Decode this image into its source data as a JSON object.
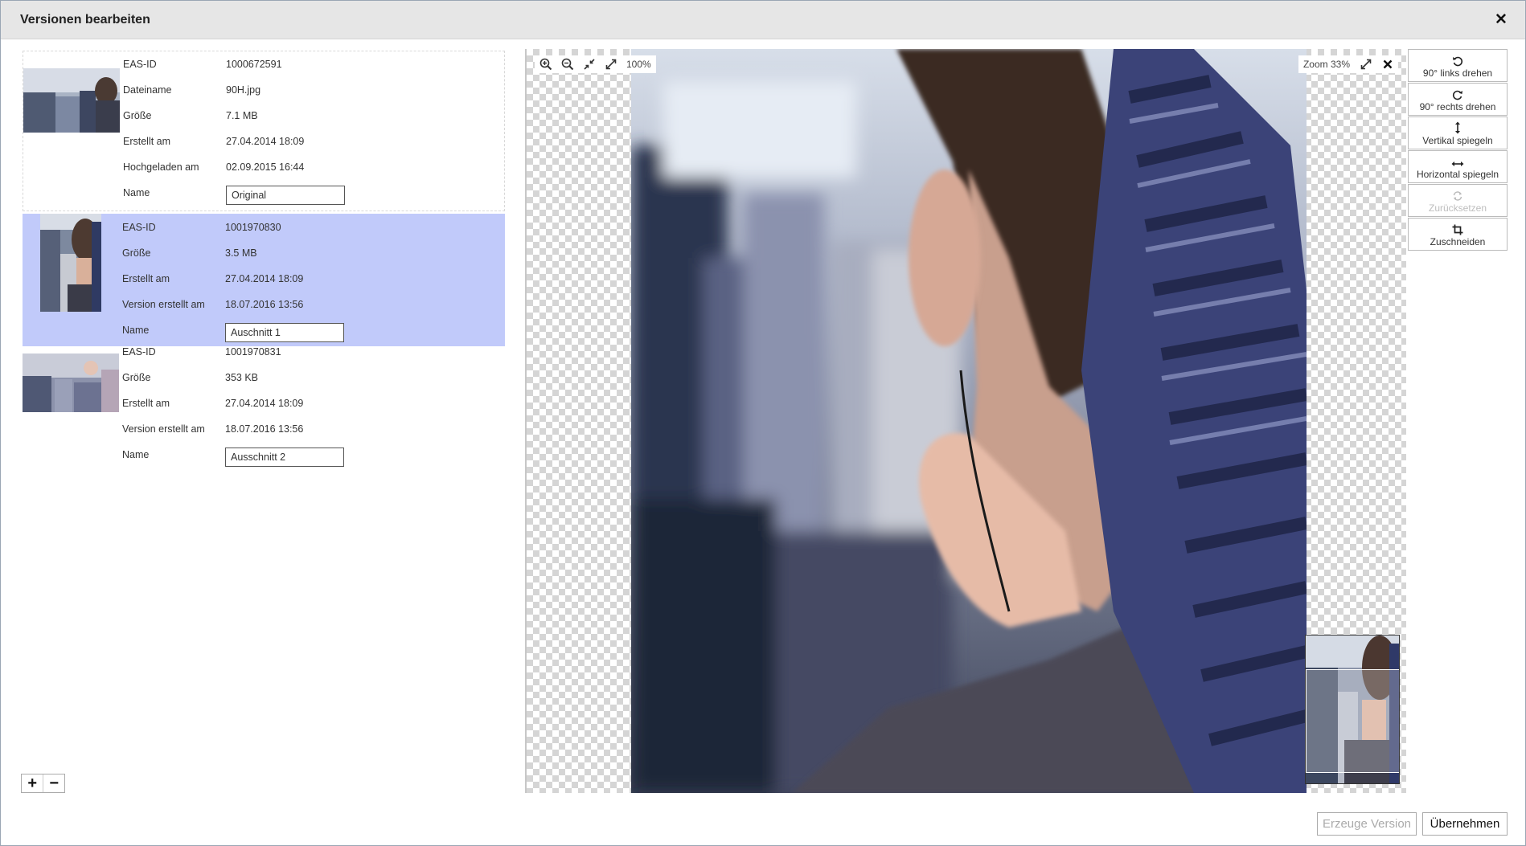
{
  "dialog": {
    "title": "Versionen bearbeiten"
  },
  "versions": [
    {
      "fields": [
        {
          "label": "EAS-ID",
          "value": "1000672591"
        },
        {
          "label": "Dateiname",
          "value": "90H.jpg"
        },
        {
          "label": "Größe",
          "value": "7.1 MB"
        },
        {
          "label": "Erstellt am",
          "value": "27.04.2014 18:09"
        },
        {
          "label": "Hochgeladen am",
          "value": "02.09.2015 16:44"
        }
      ],
      "name_label": "Name",
      "name_value": "Original"
    },
    {
      "fields": [
        {
          "label": "EAS-ID",
          "value": "1001970830"
        },
        {
          "label": "Größe",
          "value": "3.5 MB"
        },
        {
          "label": "Erstellt am",
          "value": "27.04.2014 18:09"
        },
        {
          "label": "Version erstellt am",
          "value": "18.07.2016 13:56"
        }
      ],
      "name_label": "Name",
      "name_value": "Auschnitt 1"
    },
    {
      "fields": [
        {
          "label": "EAS-ID",
          "value": "1001970831"
        },
        {
          "label": "Größe",
          "value": "353 KB"
        },
        {
          "label": "Erstellt am",
          "value": "27.04.2014 18:09"
        },
        {
          "label": "Version erstellt am",
          "value": "18.07.2016 13:56"
        }
      ],
      "name_label": "Name",
      "name_value": "Ausschnitt 2"
    }
  ],
  "list_controls": {
    "add": "+",
    "remove": "−"
  },
  "viewer": {
    "zoom_percent_label": "100%",
    "zoom_label": "Zoom 33%"
  },
  "tools": [
    {
      "label": "90° links drehen",
      "icon": "rotate-left-icon",
      "enabled": true
    },
    {
      "label": "90° rechts drehen",
      "icon": "rotate-right-icon",
      "enabled": true
    },
    {
      "label": "Vertikal spiegeln",
      "icon": "flip-vertical-icon",
      "enabled": true
    },
    {
      "label": "Horizontal spiegeln",
      "icon": "flip-horizontal-icon",
      "enabled": true
    },
    {
      "label": "Zurücksetzen",
      "icon": "reset-icon",
      "enabled": false
    },
    {
      "label": "Zuschneiden",
      "icon": "crop-icon",
      "enabled": true
    }
  ],
  "footer": {
    "create_label": "Erzeuge Version",
    "apply_label": "Übernehmen"
  },
  "colors": {
    "selected_row": "#c1cafa",
    "title_bar": "#e6e6e6",
    "disabled_text": "#aaaaaa"
  }
}
